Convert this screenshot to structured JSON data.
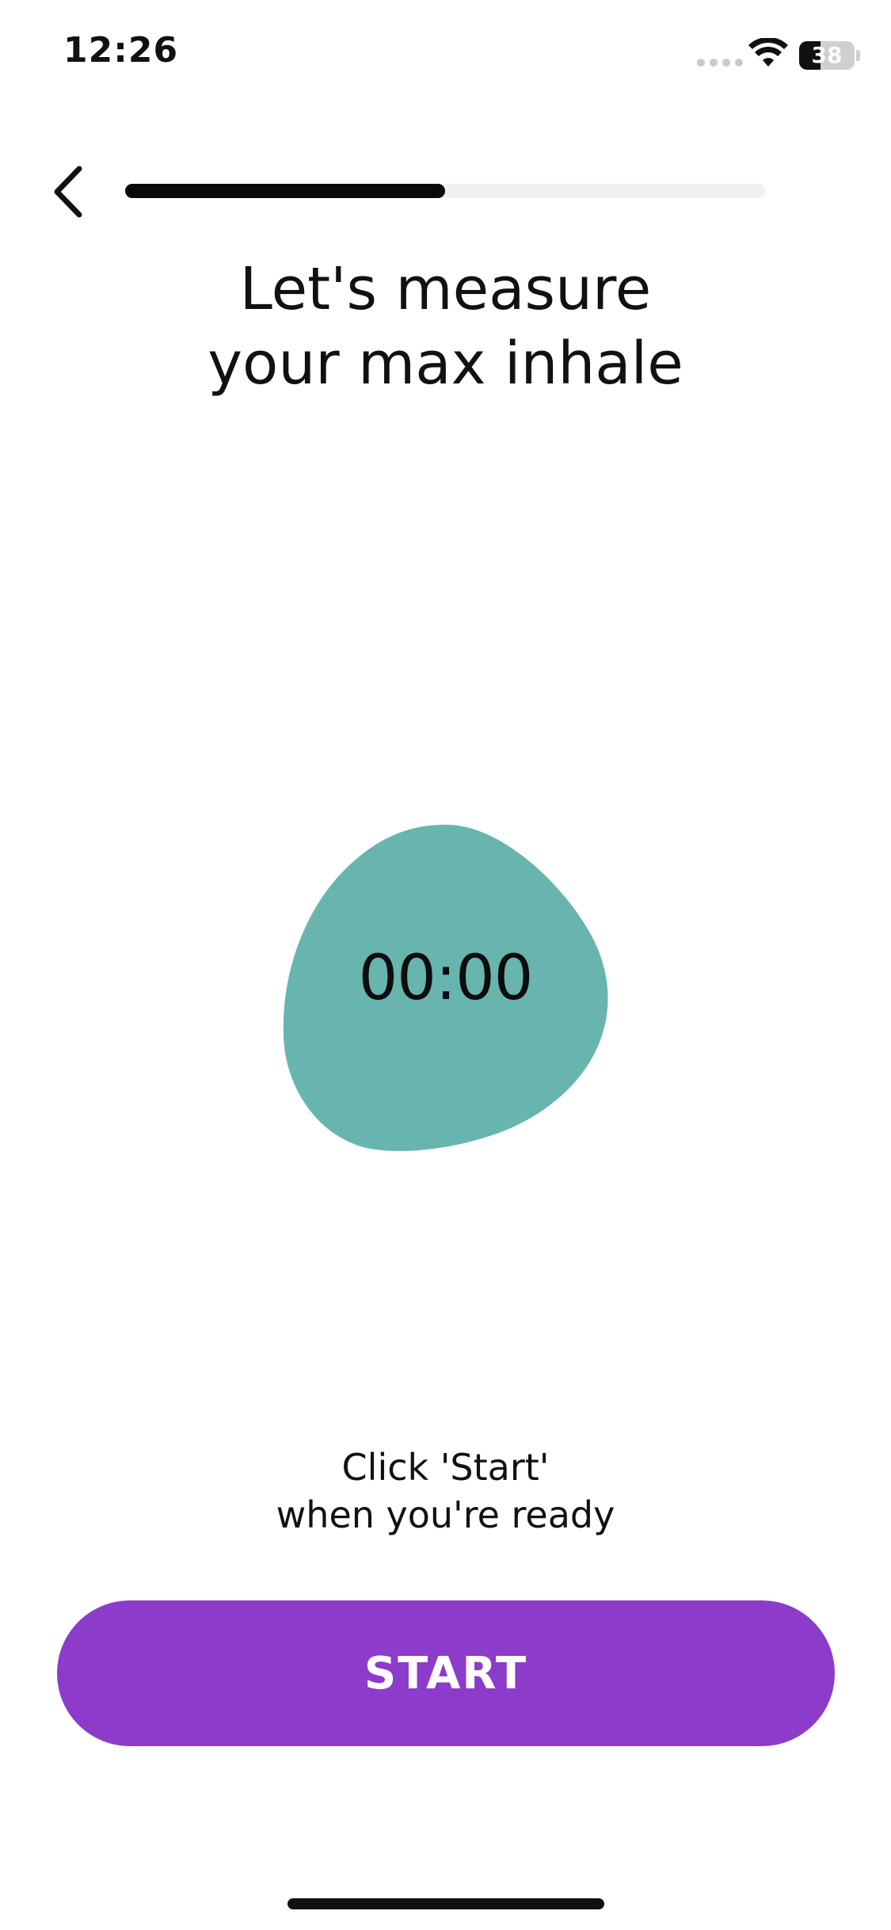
{
  "status_bar": {
    "time": "12:26",
    "battery_level": "38",
    "battery_percent": 38,
    "icons": [
      "signal-icon",
      "wifi-icon",
      "battery-icon"
    ]
  },
  "header": {
    "back_icon": "chevron-left-icon",
    "progress_fraction": 0.5
  },
  "title": {
    "line1": "Let's measure",
    "line2": "your max inhale"
  },
  "timer": {
    "value": "00:00",
    "blob_color": "#68b5b0"
  },
  "instruction": {
    "line1": "Click 'Start'",
    "line2": "when you're ready"
  },
  "start_button": {
    "label": "START",
    "color": "#8d3bcb"
  }
}
